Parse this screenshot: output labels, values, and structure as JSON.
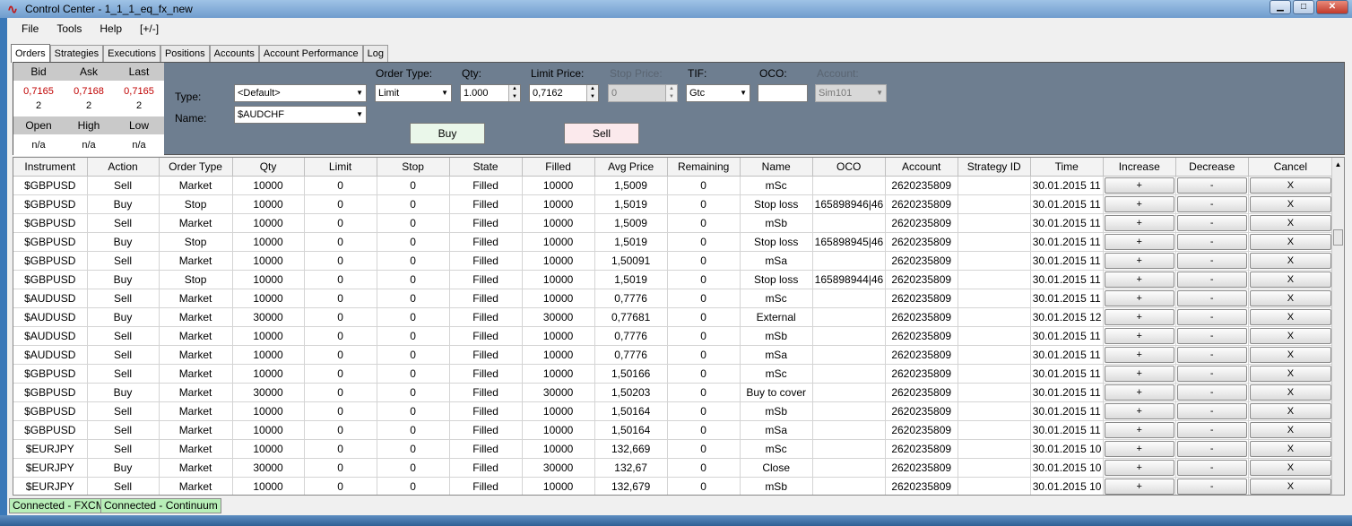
{
  "window": {
    "title": "Control Center - 1_1_1_eq_fx_new"
  },
  "menu": [
    "File",
    "Tools",
    "Help",
    "[+/-]"
  ],
  "tabs": [
    "Orders",
    "Strategies",
    "Executions",
    "Positions",
    "Accounts",
    "Account Performance",
    "Log"
  ],
  "quote": {
    "headers1": [
      "Bid",
      "Ask",
      "Last"
    ],
    "prices": [
      "0,7165",
      "0,7168",
      "0,7165"
    ],
    "sizes": [
      "2",
      "2",
      "2"
    ],
    "headers2": [
      "Open",
      "High",
      "Low"
    ],
    "values2": [
      "n/a",
      "n/a",
      "n/a"
    ]
  },
  "entry": {
    "type_label": "Type:",
    "type_value": "<Default>",
    "name_label": "Name:",
    "name_value": "$AUDCHF",
    "order_type_label": "Order Type:",
    "order_type_value": "Limit",
    "qty_label": "Qty:",
    "qty_value": "1.000",
    "limit_price_label": "Limit Price:",
    "limit_price_value": "0,7162",
    "stop_price_label": "Stop Price:",
    "stop_price_value": "0",
    "tif_label": "TIF:",
    "tif_value": "Gtc",
    "oco_label": "OCO:",
    "oco_value": "",
    "account_label": "Account:",
    "account_value": "Sim101",
    "buy_label": "Buy",
    "sell_label": "Sell"
  },
  "grid": {
    "columns": [
      "Instrument",
      "Action",
      "Order Type",
      "Qty",
      "Limit",
      "Stop",
      "State",
      "Filled",
      "Avg Price",
      "Remaining",
      "Name",
      "OCO",
      "Account",
      "Strategy ID",
      "Time",
      "Increase",
      "Decrease",
      "Cancel"
    ],
    "button_labels": {
      "increase": "+",
      "decrease": "-",
      "cancel": "X"
    },
    "rows": [
      [
        "$GBPUSD",
        "Sell",
        "Market",
        "10000",
        "0",
        "0",
        "Filled",
        "10000",
        "1,5009",
        "0",
        "mSc",
        "",
        "2620235809",
        "",
        "30.01.2015 11"
      ],
      [
        "$GBPUSD",
        "Buy",
        "Stop",
        "10000",
        "0",
        "0",
        "Filled",
        "10000",
        "1,5019",
        "0",
        "Stop loss",
        "165898946|46",
        "2620235809",
        "",
        "30.01.2015 11"
      ],
      [
        "$GBPUSD",
        "Sell",
        "Market",
        "10000",
        "0",
        "0",
        "Filled",
        "10000",
        "1,5009",
        "0",
        "mSb",
        "",
        "2620235809",
        "",
        "30.01.2015 11"
      ],
      [
        "$GBPUSD",
        "Buy",
        "Stop",
        "10000",
        "0",
        "0",
        "Filled",
        "10000",
        "1,5019",
        "0",
        "Stop loss",
        "165898945|46",
        "2620235809",
        "",
        "30.01.2015 11"
      ],
      [
        "$GBPUSD",
        "Sell",
        "Market",
        "10000",
        "0",
        "0",
        "Filled",
        "10000",
        "1,50091",
        "0",
        "mSa",
        "",
        "2620235809",
        "",
        "30.01.2015 11"
      ],
      [
        "$GBPUSD",
        "Buy",
        "Stop",
        "10000",
        "0",
        "0",
        "Filled",
        "10000",
        "1,5019",
        "0",
        "Stop loss",
        "165898944|46",
        "2620235809",
        "",
        "30.01.2015 11"
      ],
      [
        "$AUDUSD",
        "Sell",
        "Market",
        "10000",
        "0",
        "0",
        "Filled",
        "10000",
        "0,7776",
        "0",
        "mSc",
        "",
        "2620235809",
        "",
        "30.01.2015 11"
      ],
      [
        "$AUDUSD",
        "Buy",
        "Market",
        "30000",
        "0",
        "0",
        "Filled",
        "30000",
        "0,77681",
        "0",
        "External",
        "",
        "2620235809",
        "",
        "30.01.2015 12"
      ],
      [
        "$AUDUSD",
        "Sell",
        "Market",
        "10000",
        "0",
        "0",
        "Filled",
        "10000",
        "0,7776",
        "0",
        "mSb",
        "",
        "2620235809",
        "",
        "30.01.2015 11"
      ],
      [
        "$AUDUSD",
        "Sell",
        "Market",
        "10000",
        "0",
        "0",
        "Filled",
        "10000",
        "0,7776",
        "0",
        "mSa",
        "",
        "2620235809",
        "",
        "30.01.2015 11"
      ],
      [
        "$GBPUSD",
        "Sell",
        "Market",
        "10000",
        "0",
        "0",
        "Filled",
        "10000",
        "1,50166",
        "0",
        "mSc",
        "",
        "2620235809",
        "",
        "30.01.2015 11"
      ],
      [
        "$GBPUSD",
        "Buy",
        "Market",
        "30000",
        "0",
        "0",
        "Filled",
        "30000",
        "1,50203",
        "0",
        "Buy to cover",
        "",
        "2620235809",
        "",
        "30.01.2015 11"
      ],
      [
        "$GBPUSD",
        "Sell",
        "Market",
        "10000",
        "0",
        "0",
        "Filled",
        "10000",
        "1,50164",
        "0",
        "mSb",
        "",
        "2620235809",
        "",
        "30.01.2015 11"
      ],
      [
        "$GBPUSD",
        "Sell",
        "Market",
        "10000",
        "0",
        "0",
        "Filled",
        "10000",
        "1,50164",
        "0",
        "mSa",
        "",
        "2620235809",
        "",
        "30.01.2015 11"
      ],
      [
        "$EURJPY",
        "Sell",
        "Market",
        "10000",
        "0",
        "0",
        "Filled",
        "10000",
        "132,669",
        "0",
        "mSc",
        "",
        "2620235809",
        "",
        "30.01.2015 10"
      ],
      [
        "$EURJPY",
        "Buy",
        "Market",
        "30000",
        "0",
        "0",
        "Filled",
        "30000",
        "132,67",
        "0",
        "Close",
        "",
        "2620235809",
        "",
        "30.01.2015 10"
      ],
      [
        "$EURJPY",
        "Sell",
        "Market",
        "10000",
        "0",
        "0",
        "Filled",
        "10000",
        "132,679",
        "0",
        "mSb",
        "",
        "2620235809",
        "",
        "30.01.2015 10"
      ]
    ]
  },
  "status": [
    "Connected - FXCM",
    "Connected - Continuum"
  ],
  "colors": {
    "panel": "#6e7e90",
    "connected": "#b8eeb8",
    "buy": "#eaf7ea",
    "sell": "#fbe9ec"
  }
}
